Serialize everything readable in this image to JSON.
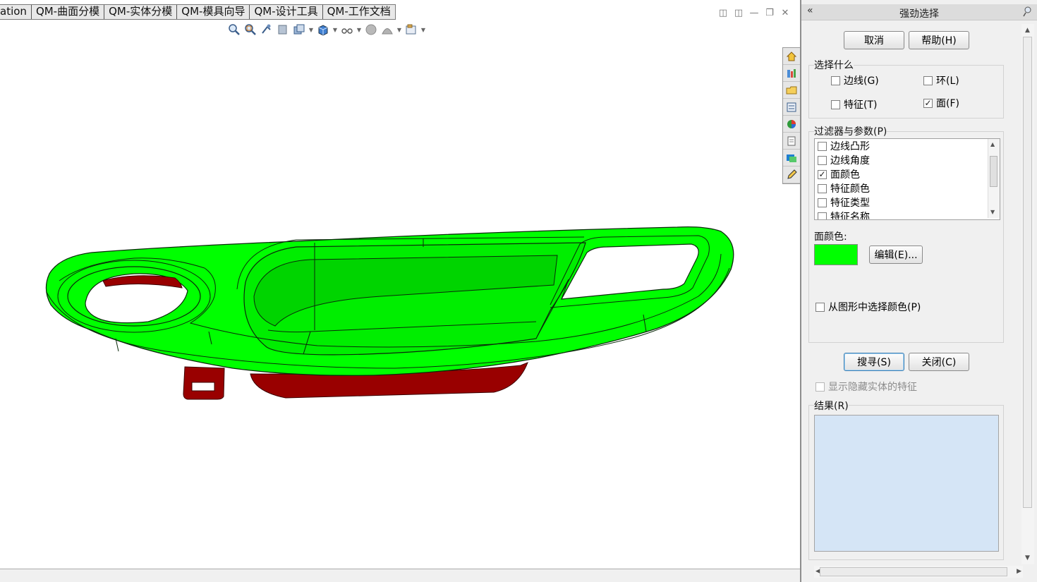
{
  "command_tabs": [
    "ation",
    "QM-曲面分模",
    "QM-实体分模",
    "QM-模具向导",
    "QM-设计工具",
    "QM-工作文档"
  ],
  "panel": {
    "title": "强劲选择",
    "cancel": "取消",
    "help": "帮助(H)",
    "select_what": {
      "label": "选择什么",
      "edges": {
        "label": "边线(G)",
        "checked": false
      },
      "loops": {
        "label": "环(L)",
        "checked": false
      },
      "features": {
        "label": "特征(T)",
        "checked": false
      },
      "faces": {
        "label": "面(F)",
        "checked": true
      }
    },
    "filters": {
      "label": "过滤器与参数(P)",
      "items": [
        {
          "label": "边线凸形",
          "checked": false
        },
        {
          "label": "边线角度",
          "checked": false
        },
        {
          "label": "面颜色",
          "checked": true
        },
        {
          "label": "特征颜色",
          "checked": false
        },
        {
          "label": "特征类型",
          "checked": false
        },
        {
          "label": "特征名称",
          "checked": false
        }
      ]
    },
    "face_color": {
      "label": "面颜色:",
      "color": "#00ff00",
      "edit_button": "编辑(E)..."
    },
    "pick_color": {
      "label": "从图形中选择颜色(P)",
      "checked": false
    },
    "search": "搜寻(S)",
    "close": "关闭(C)",
    "show_hidden": {
      "label": "显示隐藏实体的特征",
      "checked": false,
      "disabled": true
    },
    "results": {
      "label": "结果(R)"
    }
  },
  "model_colors": {
    "top_face": "#00ff00",
    "underside": "#990000"
  }
}
